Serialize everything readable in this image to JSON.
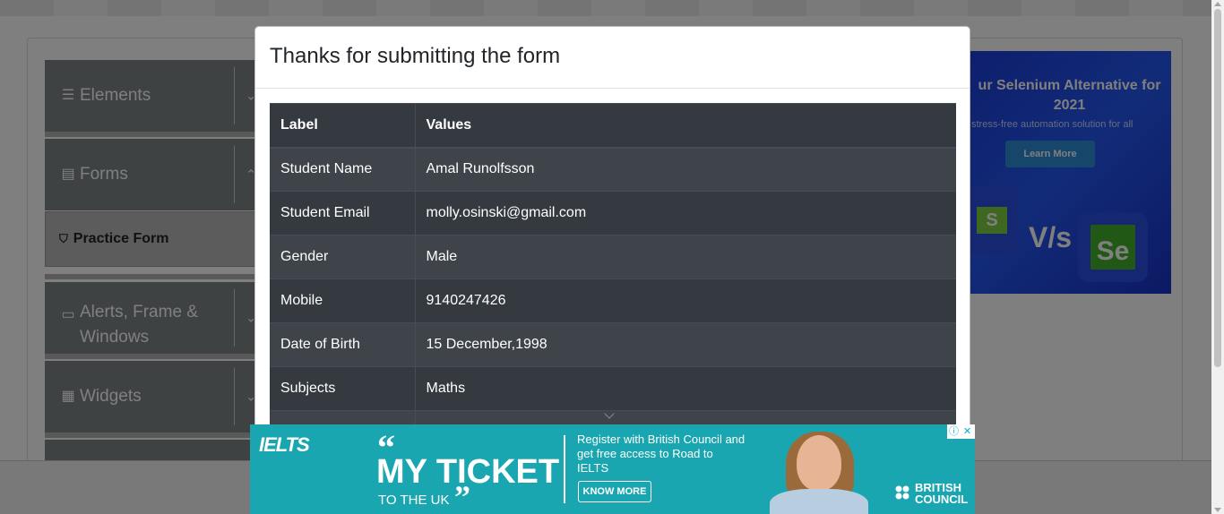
{
  "sidebar": {
    "groups": [
      {
        "label": "Elements",
        "icon": "hamburger-icon"
      },
      {
        "label": "Forms",
        "icon": "document-icon"
      },
      {
        "label": "Alerts, Frame & Windows",
        "icon": "window-icon"
      },
      {
        "label": "Widgets",
        "icon": "widgets-icon"
      }
    ],
    "active_item": {
      "label": "Practice Form",
      "icon": "html5-icon"
    }
  },
  "top_ad": {
    "headline": "ur Selenium Alternative for 2021",
    "subline": "stress-free automation solution for all",
    "button": "Learn More",
    "vs": "V/s",
    "s_logo": "S",
    "se_logo": "Se"
  },
  "modal": {
    "title": "Thanks for submitting the form",
    "columns": [
      "Label",
      "Values"
    ],
    "rows": [
      [
        "Student Name",
        "Amal Runolfsson"
      ],
      [
        "Student Email",
        "molly.osinski@gmail.com"
      ],
      [
        "Gender",
        "Male"
      ],
      [
        "Mobile",
        "9140247426"
      ],
      [
        "Date of Birth",
        "15 December,1998"
      ],
      [
        "Subjects",
        "Maths"
      ]
    ]
  },
  "bottom_ad": {
    "brand": "IELTS",
    "open_quote": "“",
    "headline": "MY TICKET",
    "subline": "TO THE UK",
    "close_quote": "”",
    "register_text": "Register with British Council and get free access to Road to IELTS",
    "button": "KNOW MORE",
    "sponsor": "BRITISH COUNCIL"
  },
  "adchoices": {
    "info": "ⓘ",
    "close": "✕"
  }
}
